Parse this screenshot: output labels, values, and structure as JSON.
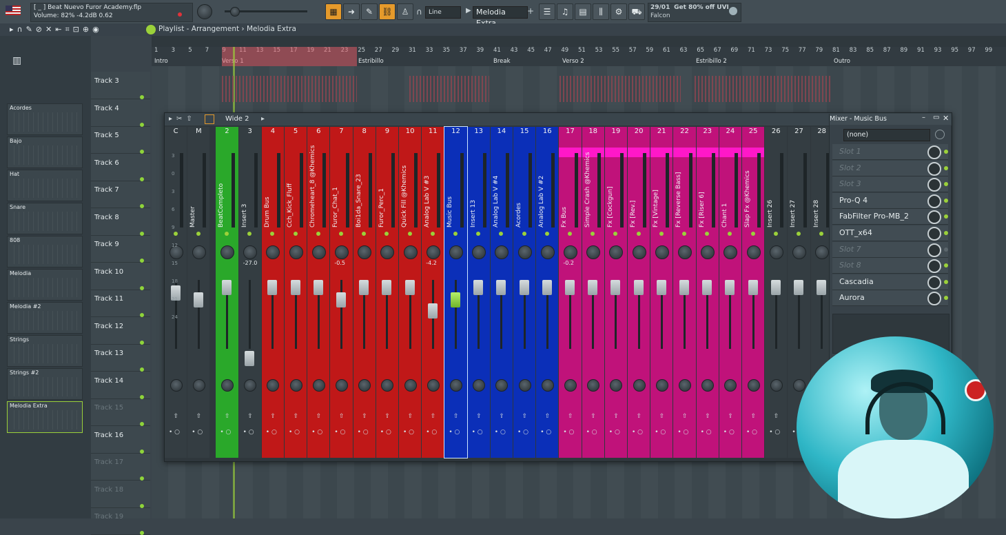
{
  "topbar": {
    "project_file": "[ _ ] Beat Nuevo Furor Academy.flp",
    "status": "Volume: 82%   -4.2dB   0.62",
    "snap": "Line",
    "pattern": "Melodia Extra",
    "news_date": "29/01",
    "news_text": "Get 80% off UVI",
    "news_sub": "Falcon"
  },
  "breadcrumb": "Playlist - Arrangement › Melodia Extra",
  "rack": {
    "items": [
      "Acordes",
      "Bajo",
      "Hat",
      "Snare",
      "808",
      "Melodia",
      "Melodia #2",
      "Strings",
      "Strings #2",
      "Melodia Extra"
    ]
  },
  "playlist": {
    "tracks": [
      "Track 3",
      "Track 4",
      "Track 5",
      "Track 6",
      "Track 7",
      "Track 8",
      "Track 9",
      "Track 10",
      "Track 11",
      "Track 12",
      "Track 13",
      "Track 14",
      "Track 15",
      "Track 16",
      "Track 17",
      "Track 18",
      "Track 19"
    ],
    "ruler": [
      "1",
      "3",
      "5",
      "7",
      "9",
      "11",
      "13",
      "15",
      "17",
      "19",
      "21",
      "23",
      "25",
      "27",
      "29",
      "31",
      "33",
      "35",
      "37",
      "39",
      "41",
      "43",
      "45",
      "47",
      "49",
      "51",
      "53",
      "55",
      "57",
      "59",
      "61",
      "63",
      "65",
      "67",
      "69",
      "71",
      "73",
      "75",
      "77",
      "79",
      "81",
      "83",
      "85",
      "87",
      "89",
      "91",
      "93",
      "95",
      "97",
      "99"
    ],
    "sections": [
      "Intro",
      "Verso 1",
      "Estribillo",
      "Break",
      "Verso 2",
      "Estribillo 2",
      "Outro"
    ]
  },
  "mixer": {
    "layout": "Wide 2",
    "strips": [
      {
        "num": "C",
        "name": "",
        "color": "#343d42"
      },
      {
        "num": "M",
        "name": "Master",
        "color": "#343d42"
      },
      {
        "num": "2",
        "name": "BeatCompleto",
        "color": "#2aa82a"
      },
      {
        "num": "3",
        "name": "Insert 3",
        "color": "#343d42",
        "val": "-27.0"
      },
      {
        "num": "4",
        "name": "Drum Bus",
        "color": "#c01818"
      },
      {
        "num": "5",
        "name": "Cch_Kick_Fluff",
        "color": "#c01818"
      },
      {
        "num": "6",
        "name": "Chromeheart_8 @Khemics",
        "color": "#c01818"
      },
      {
        "num": "7",
        "name": "Furor_Chat_1",
        "color": "#c01818",
        "val": "-0.5"
      },
      {
        "num": "8",
        "name": "Boi1da_Snare_23",
        "color": "#c01818"
      },
      {
        "num": "9",
        "name": "Furor_Perc_1",
        "color": "#c01818"
      },
      {
        "num": "10",
        "name": "Quick Fill @Khemics",
        "color": "#c01818"
      },
      {
        "num": "11",
        "name": "Analog Lab V #3",
        "color": "#c01818",
        "val": "-4.2"
      },
      {
        "num": "12",
        "name": "Music Bus",
        "color": "#0b2fb8"
      },
      {
        "num": "13",
        "name": "Insert 13",
        "color": "#0b2fb8"
      },
      {
        "num": "14",
        "name": "Analog Lab V #4",
        "color": "#0b2fb8"
      },
      {
        "num": "15",
        "name": "Acordes",
        "color": "#0b2fb8"
      },
      {
        "num": "16",
        "name": "Analog Lab V #2",
        "color": "#0b2fb8"
      },
      {
        "num": "17",
        "name": "Fx Bus",
        "color": "#c0127a",
        "val": "-0.2"
      },
      {
        "num": "18",
        "name": "Simple Crash @Khemics",
        "color": "#c0127a"
      },
      {
        "num": "19",
        "name": "Fx [Cockgun]",
        "color": "#c0127a"
      },
      {
        "num": "20",
        "name": "Fx [Rev.]",
        "color": "#c0127a"
      },
      {
        "num": "21",
        "name": "Fx [Vintage]",
        "color": "#c0127a"
      },
      {
        "num": "22",
        "name": "Fx [Reverse Bass]",
        "color": "#c0127a"
      },
      {
        "num": "23",
        "name": "Fx [Riser 6]",
        "color": "#c0127a"
      },
      {
        "num": "24",
        "name": "Chant 1",
        "color": "#c0127a"
      },
      {
        "num": "25",
        "name": "Slap Fx @Khemics",
        "color": "#c0127a"
      },
      {
        "num": "26",
        "name": "Insert 26",
        "color": "#343d42"
      },
      {
        "num": "27",
        "name": "Insert 27",
        "color": "#343d42"
      },
      {
        "num": "28",
        "name": "Insert 28",
        "color": "#343d42"
      }
    ],
    "panel": {
      "title": "Mixer - Music Bus",
      "preset": "(none)",
      "slots": [
        {
          "label": "Slot 1",
          "empty": true
        },
        {
          "label": "Slot 2",
          "empty": true
        },
        {
          "label": "Slot 3",
          "empty": true
        },
        {
          "label": "Pro-Q 4",
          "empty": false
        },
        {
          "label": "FabFilter Pro-MB_2",
          "empty": false
        },
        {
          "label": "OTT_x64",
          "empty": false
        },
        {
          "label": "Slot 7",
          "empty": true
        },
        {
          "label": "Slot 8",
          "empty": true
        },
        {
          "label": "Cascadia",
          "empty": false
        },
        {
          "label": "Aurora",
          "empty": false
        }
      ]
    },
    "db_scale": [
      "3",
      "0",
      "3",
      "6",
      "9",
      "12",
      "15",
      "18",
      "21",
      "24"
    ]
  }
}
